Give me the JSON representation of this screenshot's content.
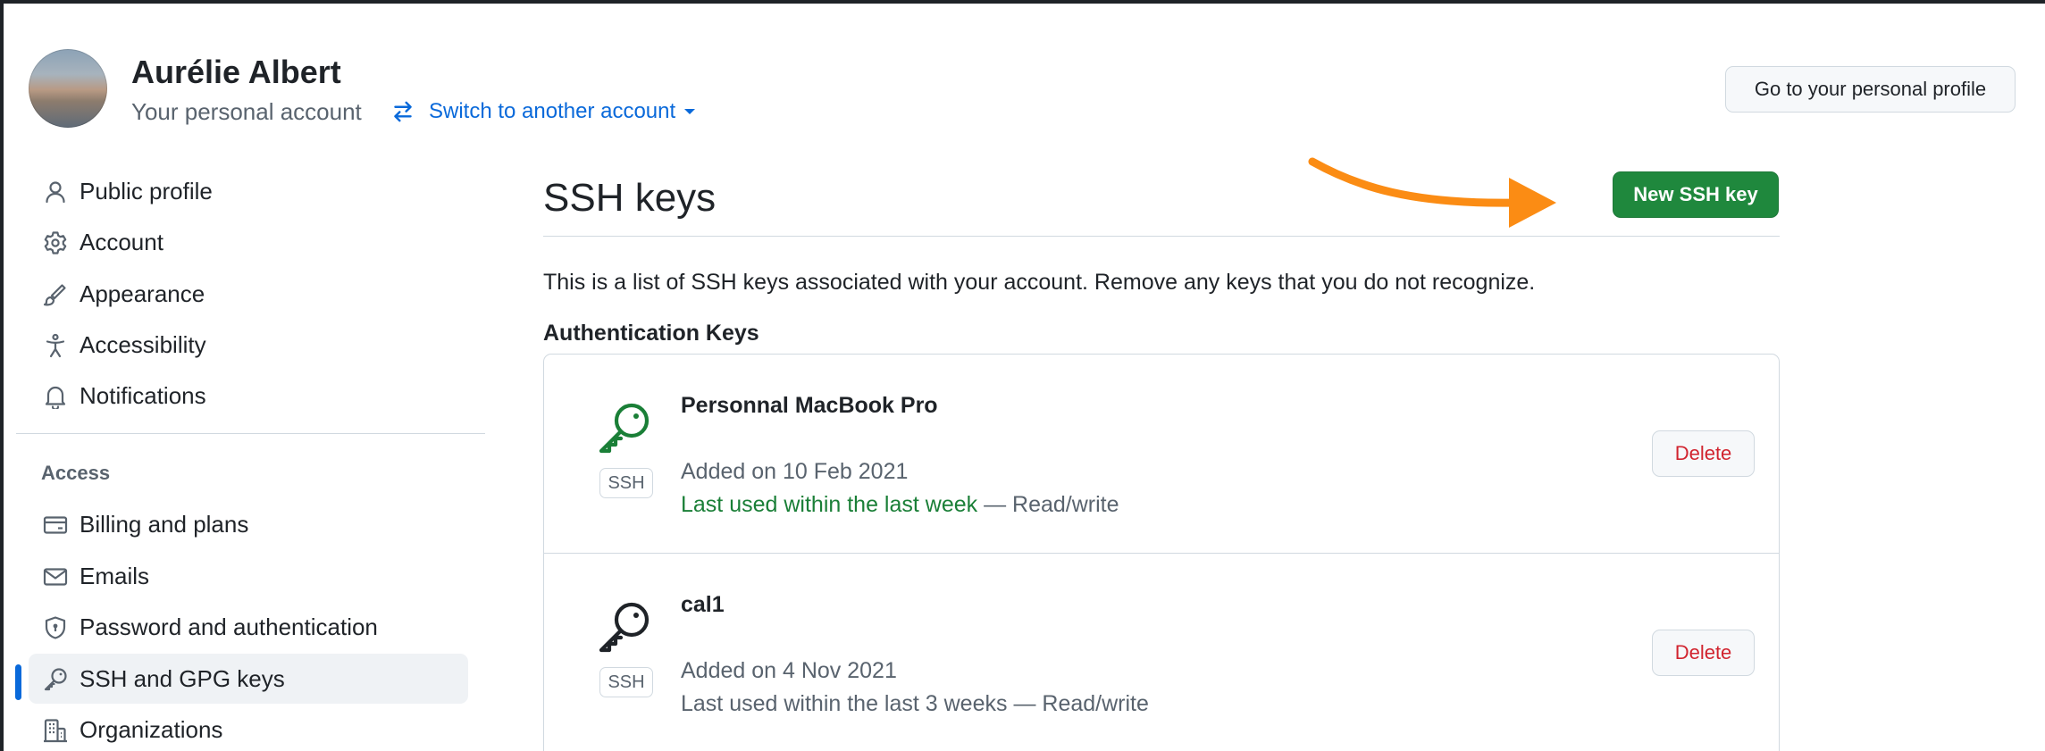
{
  "header": {
    "user_name": "Aurélie Albert",
    "subtitle": "Your personal account",
    "switch_account_label": "Switch to another account",
    "profile_button_label": "Go to your personal profile"
  },
  "sidebar": {
    "items": [
      {
        "label": "Public profile",
        "icon": "person-icon"
      },
      {
        "label": "Account",
        "icon": "gear-icon"
      },
      {
        "label": "Appearance",
        "icon": "paintbrush-icon"
      },
      {
        "label": "Accessibility",
        "icon": "accessibility-icon"
      },
      {
        "label": "Notifications",
        "icon": "bell-icon"
      }
    ],
    "access_heading": "Access",
    "access_items": [
      {
        "label": "Billing and plans",
        "icon": "credit-card-icon"
      },
      {
        "label": "Emails",
        "icon": "mail-icon"
      },
      {
        "label": "Password and authentication",
        "icon": "shield-lock-icon"
      },
      {
        "label": "SSH and GPG keys",
        "icon": "key-icon",
        "active": true
      },
      {
        "label": "Organizations",
        "icon": "organization-icon"
      }
    ]
  },
  "main": {
    "title": "SSH keys",
    "new_key_button": "New SSH key",
    "description": "This is a list of SSH keys associated with your account. Remove any keys that you do not recognize.",
    "section_heading": "Authentication Keys",
    "keys": [
      {
        "title": "Personnal MacBook Pro",
        "badge": "SSH",
        "added": "Added on 10 Feb 2021",
        "last_used": "Last used within the last week",
        "access": "— Read/write",
        "delete_label": "Delete",
        "recent": true
      },
      {
        "title": "cal1",
        "badge": "SSH",
        "added": "Added on 4 Nov 2021",
        "last_used": "Last used within the last 3 weeks",
        "access": "— Read/write",
        "delete_label": "Delete",
        "recent": false
      }
    ]
  },
  "colors": {
    "accent_blue": "#0969da",
    "primary_green": "#1f883d",
    "success_text": "#1a7f37",
    "danger_text": "#d1242f",
    "annotation_arrow": "#fb8c14"
  }
}
